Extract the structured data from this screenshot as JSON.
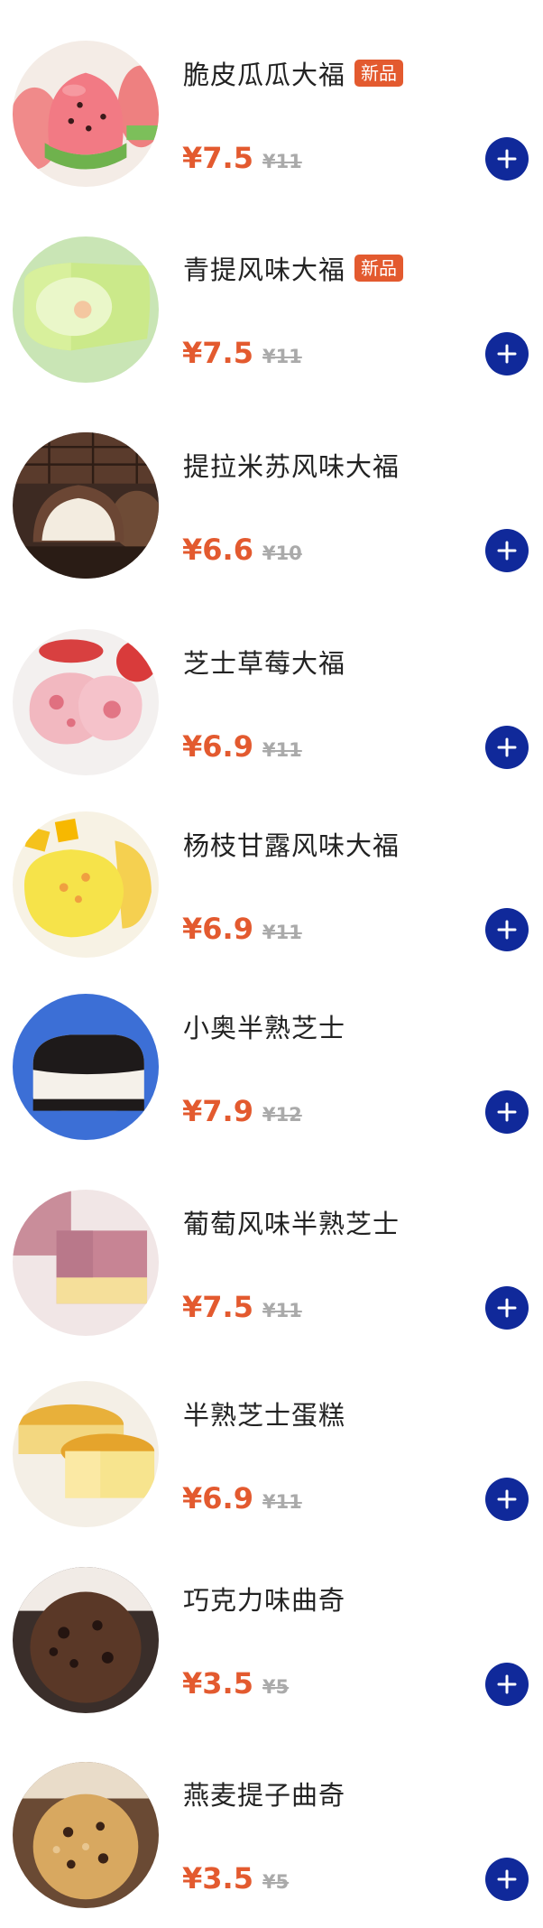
{
  "accent_color": "#e35a2f",
  "button_color": "#10299a",
  "products": [
    {
      "name": "脆皮瓜瓜大福",
      "badge": "新品",
      "price": "¥7.5",
      "original_price": "¥11",
      "image": "watermelon-mochi"
    },
    {
      "name": "青提风味大福",
      "badge": "新品",
      "price": "¥7.5",
      "original_price": "¥11",
      "image": "grape-mochi"
    },
    {
      "name": "提拉米苏风味大福",
      "badge": "",
      "price": "¥6.6",
      "original_price": "¥10",
      "image": "tiramisu-mochi"
    },
    {
      "name": "芝士草莓大福",
      "badge": "",
      "price": "¥6.9",
      "original_price": "¥11",
      "image": "strawberry-mochi"
    },
    {
      "name": "杨枝甘露风味大福",
      "badge": "",
      "price": "¥6.9",
      "original_price": "¥11",
      "image": "mango-mochi"
    },
    {
      "name": "小奥半熟芝士",
      "badge": "",
      "price": "¥7.9",
      "original_price": "¥12",
      "image": "oreo-cheese"
    },
    {
      "name": "葡萄风味半熟芝士",
      "badge": "",
      "price": "¥7.5",
      "original_price": "¥11",
      "image": "grape-cheese"
    },
    {
      "name": "半熟芝士蛋糕",
      "badge": "",
      "price": "¥6.9",
      "original_price": "¥11",
      "image": "cheese-cake"
    },
    {
      "name": "巧克力味曲奇",
      "badge": "",
      "price": "¥3.5",
      "original_price": "¥5",
      "image": "chocolate-cookie"
    },
    {
      "name": "燕麦提子曲奇",
      "badge": "",
      "price": "¥3.5",
      "original_price": "¥5",
      "image": "oat-raisin-cookie"
    }
  ]
}
